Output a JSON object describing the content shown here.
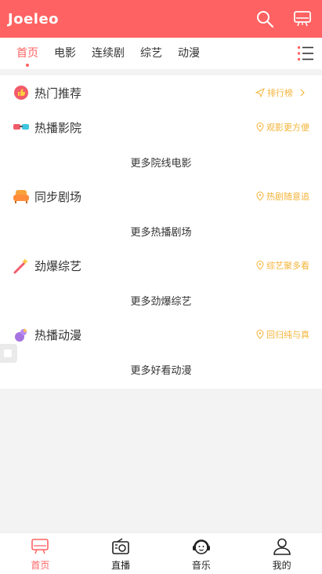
{
  "header": {
    "brand": "Joeleo",
    "search_icon": "search-icon",
    "tv_icon": "tv-icon"
  },
  "tabs": [
    {
      "label": "首页",
      "active": true
    },
    {
      "label": "电影"
    },
    {
      "label": "连续剧"
    },
    {
      "label": "综艺"
    },
    {
      "label": "动漫"
    }
  ],
  "sections": {
    "hot": {
      "title": "热门推荐",
      "tag": "排行榜",
      "icon": "thumbs-up-icon"
    },
    "cinema": {
      "title": "热播影院",
      "tag": "观影更方便",
      "more": "更多院线电影",
      "icon": "3d-glasses-icon"
    },
    "drama": {
      "title": "同步剧场",
      "tag": "热剧随意追",
      "more": "更多热播剧场",
      "icon": "sofa-icon"
    },
    "variety": {
      "title": "劲爆综艺",
      "tag": "综艺聚多看",
      "more": "更多劲爆综艺",
      "icon": "magic-wand-icon"
    },
    "anime": {
      "title": "热播动漫",
      "tag": "回归纯与真",
      "more": "更多好看动漫",
      "icon": "gourd-icon"
    }
  },
  "colors": {
    "primary": "#ff6262",
    "tag": "#f4b43a"
  },
  "bottom_nav": [
    {
      "label": "首页",
      "active": true,
      "icon": "tv-icon"
    },
    {
      "label": "直播",
      "icon": "radio-icon"
    },
    {
      "label": "音乐",
      "icon": "headphones-icon"
    },
    {
      "label": "我的",
      "icon": "user-icon"
    }
  ]
}
